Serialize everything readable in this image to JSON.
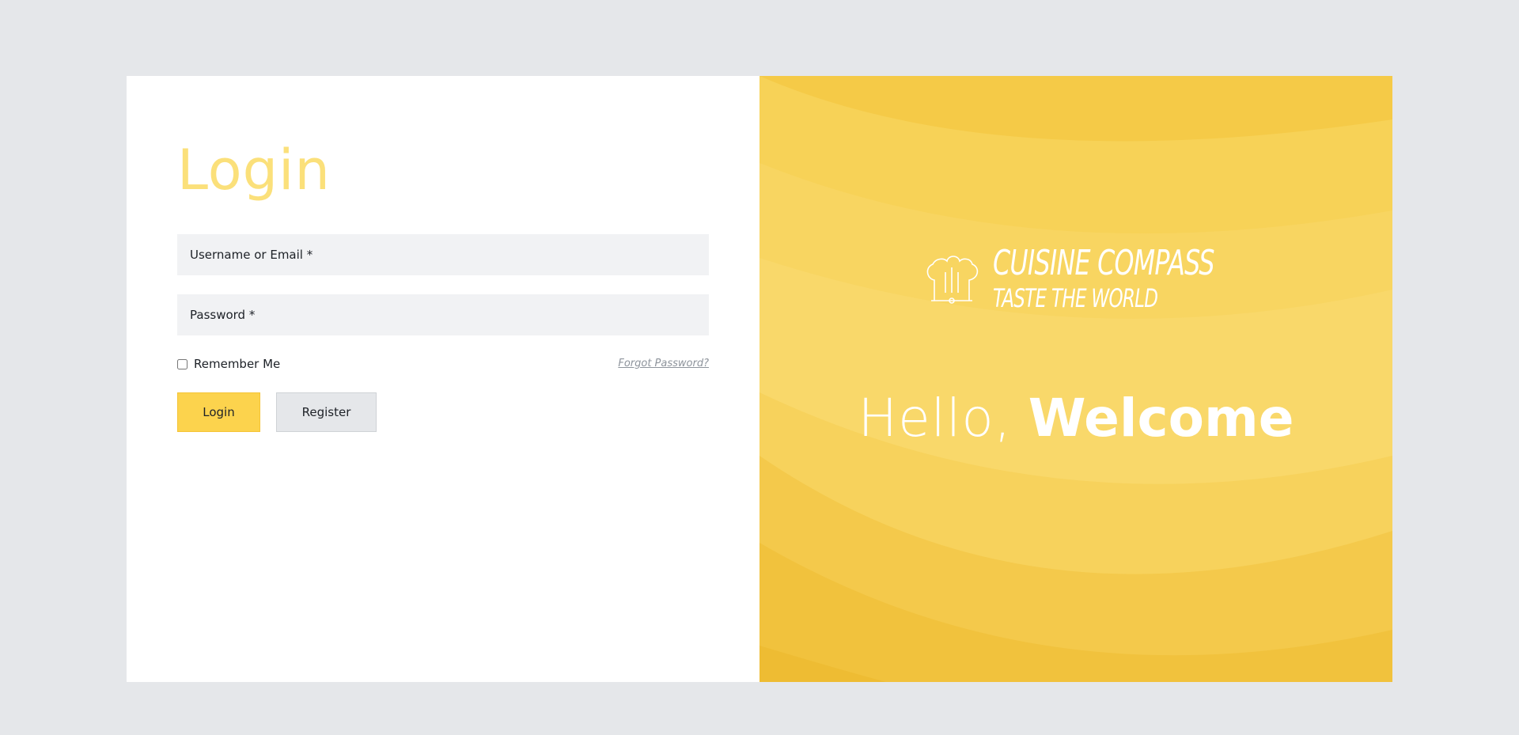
{
  "login": {
    "title": "Login",
    "username_placeholder": "Username or Email *",
    "password_placeholder": "Password *",
    "remember_label": "Remember Me",
    "forgot_link": "Forgot Password?",
    "login_button": "Login",
    "register_button": "Register"
  },
  "welcome": {
    "brand_name": "CUISINE COMPASS",
    "brand_tagline": "TASTE THE WORLD",
    "greeting_light": "Hello,",
    "greeting_bold": "Welcome",
    "logo_icon": "chef-hat-icon"
  },
  "colors": {
    "accent": "#fcd34d",
    "title": "#fbe07a",
    "panel": "#f5ca47",
    "background": "#e5e7ea"
  }
}
